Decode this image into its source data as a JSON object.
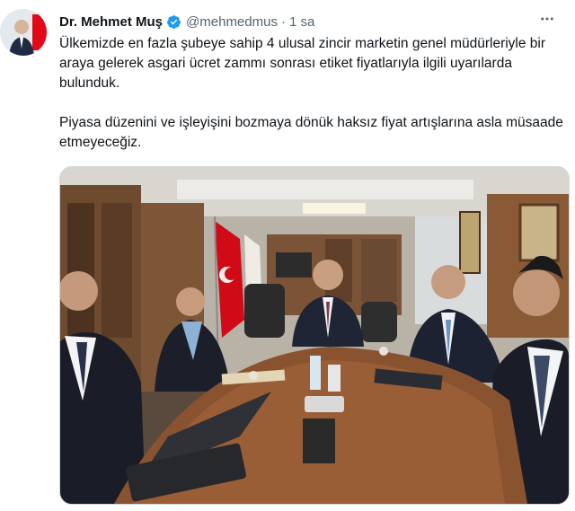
{
  "tweet": {
    "author_name": "Dr. Mehmet Muş",
    "handle": "@mehmedmus",
    "separator": "·",
    "time": "1 sa",
    "paragraphs": [
      "Ülkemizde en fazla şubeye sahip 4 ulusal zincir marketin genel müdürleriyle bir araya gelerek asgari ücret zammı sonrası etiket fiyatlarıyla ilgili uyarılarda bulunduk.",
      "Piyasa düzenini ve işleyişini bozmaya dönük haksız fiyat artışlarına asla müsaade etmeyeceğiz."
    ]
  },
  "icons": {
    "verified": "verified-badge-icon",
    "more": "more-options-icon"
  },
  "colors": {
    "text": "#0f1419",
    "muted": "#536471",
    "verified": "#1d9bf0",
    "border": "#cfd9de",
    "flag_red": "#e30a17"
  }
}
